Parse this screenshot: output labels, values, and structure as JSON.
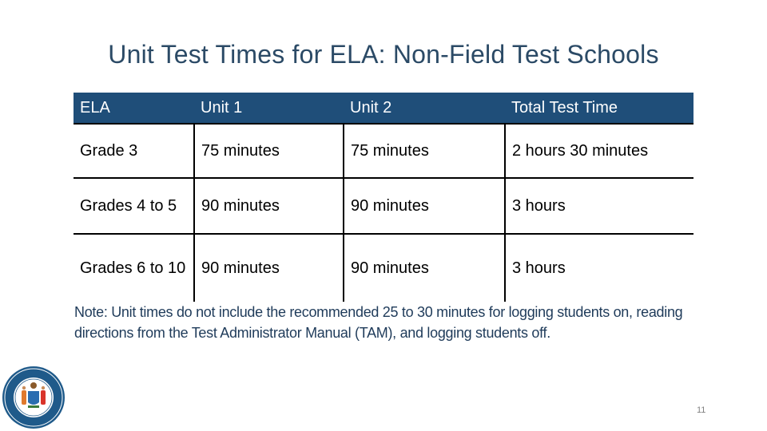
{
  "slide": {
    "title": "Unit Test Times for ELA: Non-Field Test Schools",
    "page_number": "11",
    "logo": "nj-department-of-education-seal",
    "colors": {
      "header_bg": "#1f4e79",
      "title": "#2b4a66",
      "note": "#1f3b5a"
    }
  },
  "table": {
    "headers": [
      "ELA",
      "Unit 1",
      "Unit 2",
      "Total Test Time"
    ],
    "rows": [
      [
        "Grade 3",
        "75 minutes",
        "75 minutes",
        "2 hours 30 minutes"
      ],
      [
        "Grades 4 to 5",
        "90 minutes",
        "90 minutes",
        "3 hours"
      ],
      [
        "Grades 6 to 10",
        "90 minutes",
        "90 minutes",
        "3 hours"
      ]
    ]
  },
  "note": "Note: Unit times do not include the recommended 25 to 30 minutes for logging students on, reading directions from the Test Administrator Manual (TAM), and logging students off."
}
